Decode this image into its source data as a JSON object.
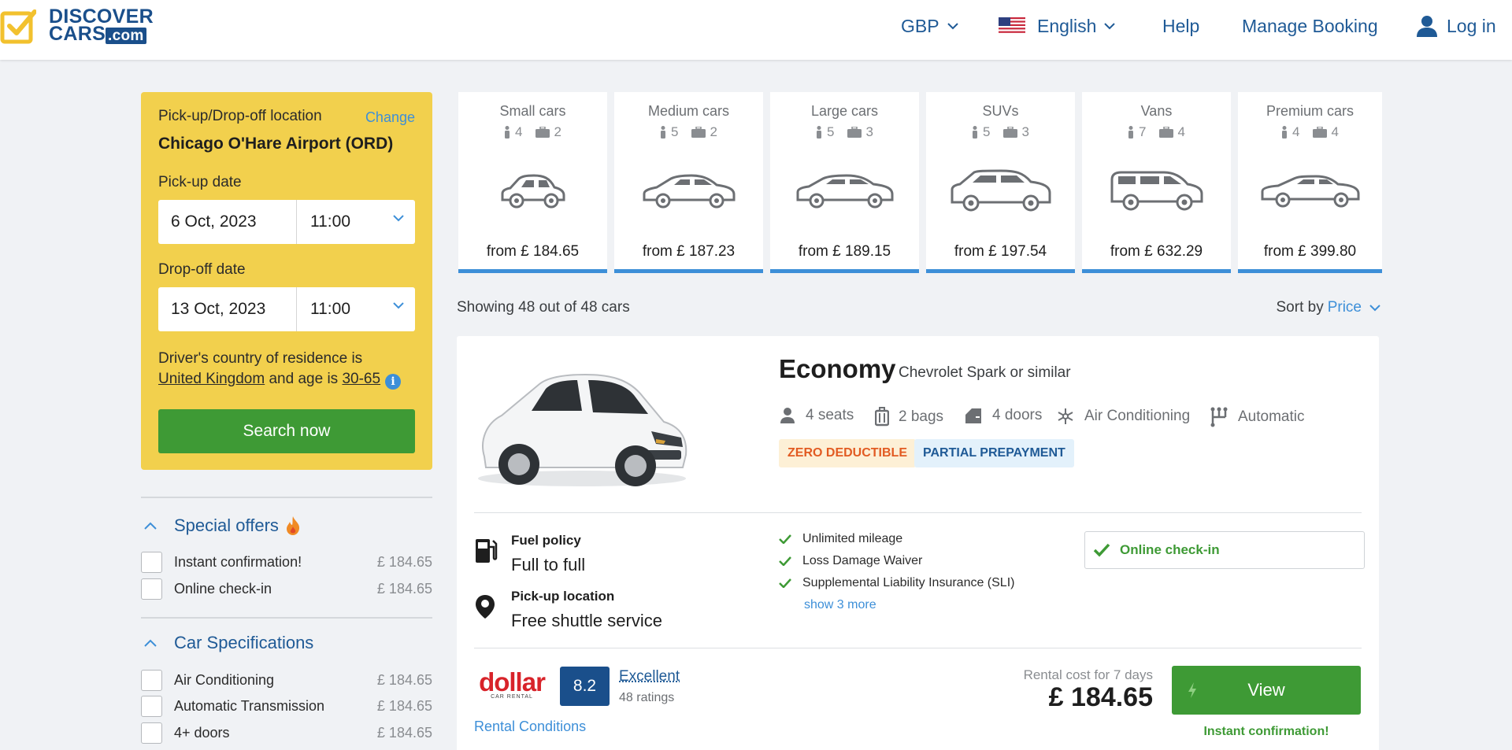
{
  "header": {
    "logo_line1": "DISCOVER",
    "logo_line2": "CARS",
    "logo_dotcom": ".com",
    "currency": "GBP",
    "language": "English",
    "help": "Help",
    "manage_booking": "Manage Booking",
    "login": "Log in"
  },
  "search": {
    "location_label": "Pick-up/Drop-off location",
    "change": "Change",
    "location": "Chicago O'Hare Airport (ORD)",
    "pickup_label": "Pick-up date",
    "pickup_date": "6 Oct, 2023",
    "pickup_time": "11:00",
    "dropoff_label": "Drop-off date",
    "dropoff_date": "13 Oct, 2023",
    "dropoff_time": "11:00",
    "driver_pre": "Driver's country of residence is",
    "country": "United Kingdom",
    "age_pre": "and age is",
    "age": "30-65",
    "info": "i",
    "button": "Search now"
  },
  "filters": {
    "special_offers": {
      "title": "Special offers",
      "items": [
        {
          "label": "Instant confirmation!",
          "price": "£ 184.65"
        },
        {
          "label": "Online check-in",
          "price": "£ 184.65"
        }
      ]
    },
    "car_specs": {
      "title": "Car Specifications",
      "items": [
        {
          "label": "Air Conditioning",
          "price": "£ 184.65"
        },
        {
          "label": "Automatic Transmission",
          "price": "£ 184.65"
        },
        {
          "label": "4+ doors",
          "price": "£ 184.65"
        }
      ]
    }
  },
  "categories": [
    {
      "name": "Small cars",
      "seats": "4",
      "bags": "2",
      "price": "from £ 184.65"
    },
    {
      "name": "Medium cars",
      "seats": "5",
      "bags": "2",
      "price": "from £ 187.23"
    },
    {
      "name": "Large cars",
      "seats": "5",
      "bags": "3",
      "price": "from £ 189.15"
    },
    {
      "name": "SUVs",
      "seats": "5",
      "bags": "3",
      "price": "from £ 197.54"
    },
    {
      "name": "Vans",
      "seats": "7",
      "bags": "4",
      "price": "from £ 632.29"
    },
    {
      "name": "Premium cars",
      "seats": "4",
      "bags": "4",
      "price": "from £ 399.80"
    }
  ],
  "results": {
    "showing": "Showing 48 out of 48 cars",
    "sort_label": "Sort by",
    "sort_value": "Price"
  },
  "card": {
    "class": "Economy",
    "model": "Chevrolet Spark or similar",
    "features": {
      "seats": "4 seats",
      "bags": "2 bags",
      "doors": "4 doors",
      "ac": "Air Conditioning",
      "transmission": "Automatic"
    },
    "badge_deductible": "ZERO DEDUCTIBLE",
    "badge_prepay": "PARTIAL PREPAYMENT",
    "fuel_label": "Fuel policy",
    "fuel_value": "Full to full",
    "pickup_label": "Pick-up location",
    "pickup_value": "Free shuttle service",
    "inclusions": [
      "Unlimited mileage",
      "Loss Damage Waiver",
      "Supplemental Liability Insurance (SLI)"
    ],
    "show_more": "show 3 more",
    "checkin": "Online check-in",
    "supplier": "dollar",
    "supplier_sub": "CAR RENTAL",
    "rating": "8.2",
    "rating_text": "Excellent",
    "rating_count": "48 ratings",
    "rental_conditions": "Rental Conditions",
    "rental_label": "Rental cost for 7 days",
    "price": "£ 184.65",
    "view": "View",
    "instant": "Instant confirmation!"
  },
  "colors": {
    "brand_blue": "#1a4f8b",
    "link_blue": "#3d8fd8",
    "panel_yellow": "#f2d04d",
    "green": "#3e9a35"
  }
}
